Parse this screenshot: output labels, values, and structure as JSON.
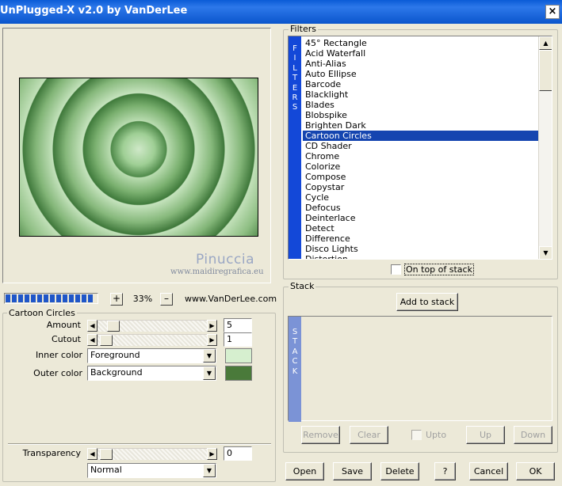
{
  "window": {
    "title": "UnPlugged-X v2.0 by VanDerLee",
    "close_glyph": "×"
  },
  "preview": {
    "watermark_name": "Pinuccia",
    "watermark_site": "www.maidiregrafica.eu"
  },
  "toolbar": {
    "progress_fraction": 1.0,
    "zoom_plus": "+",
    "zoom_value": "33%",
    "zoom_minus": "–",
    "website": "www.VanDerLee.com"
  },
  "params": {
    "group_title": "Cartoon Circles",
    "amount_label": "Amount",
    "amount_value": "5",
    "cutout_label": "Cutout",
    "cutout_value": "1",
    "inner_color_label": "Inner color",
    "inner_color_value": "Foreground",
    "inner_color_swatch": "#d6efcf",
    "outer_color_label": "Outer color",
    "outer_color_value": "Background",
    "outer_color_swatch": "#4a7a3a",
    "transparency_label": "Transparency",
    "transparency_value": "0",
    "blend_mode": "Normal"
  },
  "filters": {
    "group_title": "Filters",
    "strip_letters": [
      "F",
      "I",
      "L",
      "T",
      "E",
      "R",
      "S"
    ],
    "items": [
      "45° Rectangle",
      "Acid Waterfall",
      "Anti-Alias",
      "Auto Ellipse",
      "Barcode",
      "Blacklight",
      "Blades",
      "Blobspike",
      "Brighten Dark",
      "Cartoon Circles",
      "CD Shader",
      "Chrome",
      "Colorize",
      "Compose",
      "Copystar",
      "Cycle",
      "Defocus",
      "Deinterlace",
      "Detect",
      "Difference",
      "Disco Lights",
      "Distortion"
    ],
    "selected": "Cartoon Circles",
    "on_top_label": "On top of stack"
  },
  "stack": {
    "group_title": "Stack",
    "add_label": "Add to stack",
    "strip_letters": [
      "S",
      "T",
      "A",
      "C",
      "K"
    ],
    "remove_label": "Remove",
    "clear_label": "Clear",
    "upto_label": "Upto",
    "up_label": "Up",
    "down_label": "Down"
  },
  "buttons": {
    "open": "Open",
    "save": "Save",
    "delete": "Delete",
    "help": "?",
    "cancel": "Cancel",
    "ok": "OK"
  }
}
